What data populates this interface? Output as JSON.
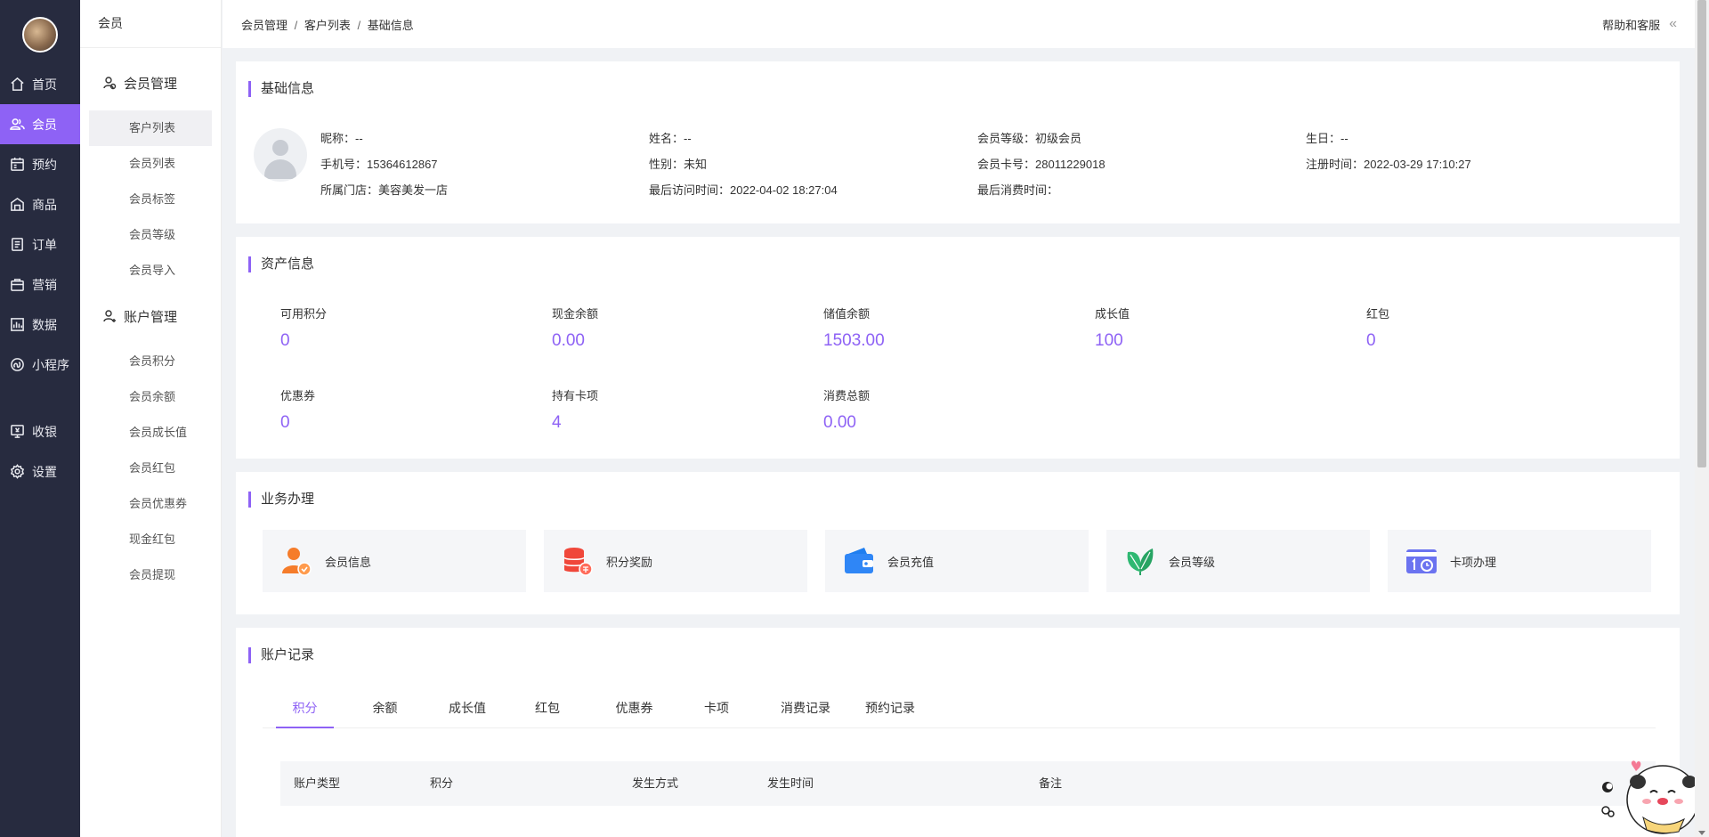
{
  "nav": {
    "items": [
      {
        "label": "首页",
        "icon": "home-icon"
      },
      {
        "label": "会员",
        "icon": "members-icon",
        "active": true
      },
      {
        "label": "预约",
        "icon": "calendar-icon"
      },
      {
        "label": "商品",
        "icon": "store-icon"
      },
      {
        "label": "订单",
        "icon": "order-icon"
      },
      {
        "label": "营销",
        "icon": "briefcase-icon"
      },
      {
        "label": "数据",
        "icon": "chart-icon"
      },
      {
        "label": "小程序",
        "icon": "miniprogram-icon"
      }
    ],
    "bottom_items": [
      {
        "label": "收银",
        "icon": "cashier-icon"
      },
      {
        "label": "设置",
        "icon": "gear-icon"
      }
    ]
  },
  "sub": {
    "head": "会员",
    "group1": "会员管理",
    "group1_links": [
      "客户列表",
      "会员列表",
      "会员标签",
      "会员等级",
      "会员导入"
    ],
    "group2": "账户管理",
    "group2_links": [
      "会员积分",
      "会员余额",
      "会员成长值",
      "会员红包",
      "会员优惠券",
      "现金红包",
      "会员提现"
    ]
  },
  "topbar": {
    "crumbs": [
      "会员管理",
      "客户列表",
      "基础信息"
    ],
    "crumb_sep": "/",
    "help": "帮助和客服",
    "collapse": "«"
  },
  "basic": {
    "title": "基础信息",
    "fields": [
      "昵称：--",
      "姓名：--",
      "会员等级：初级会员",
      "生日：--",
      "手机号：15364612867",
      "性别：未知",
      "会员卡号：28011229018",
      "注册时间：2022-03-29 17:10:27",
      "所属门店：美容美发一店",
      "最后访问时间：2022-04-02 18:27:04",
      "最后消费时间："
    ]
  },
  "assets": {
    "title": "资产信息",
    "items": [
      {
        "label": "可用积分",
        "value": "0"
      },
      {
        "label": "现金余额",
        "value": "0.00"
      },
      {
        "label": "储值余额",
        "value": "1503.00"
      },
      {
        "label": "成长值",
        "value": "100"
      },
      {
        "label": "红包",
        "value": "0"
      },
      {
        "label": "优惠券",
        "value": "0"
      },
      {
        "label": "持有卡项",
        "value": "4"
      },
      {
        "label": "消费总额",
        "value": "0.00"
      }
    ]
  },
  "business": {
    "title": "业务办理",
    "items": [
      {
        "label": "会员信息",
        "icon": "member-info-icon"
      },
      {
        "label": "积分奖励",
        "icon": "points-reward-icon"
      },
      {
        "label": "会员充值",
        "icon": "wallet-icon"
      },
      {
        "label": "会员等级",
        "icon": "leaf-icon"
      },
      {
        "label": "卡项办理",
        "icon": "card-icon"
      }
    ]
  },
  "records": {
    "title": "账户记录",
    "tabs": [
      "积分",
      "余额",
      "成长值",
      "红包",
      "优惠券",
      "卡项",
      "消费记录",
      "预约记录"
    ],
    "active_tab": "积分",
    "columns": [
      "账户类型",
      "积分",
      "发生方式",
      "发生时间",
      "备注"
    ]
  },
  "colors": {
    "accent": "#8e62f5",
    "sidebar": "#272b3f"
  }
}
